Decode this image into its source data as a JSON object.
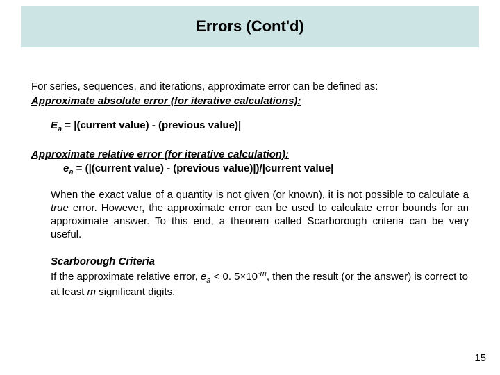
{
  "title": "Errors (Cont'd)",
  "intro": "For series, sequences, and iterations,  approximate error can be defined as:",
  "abs_error_head": "Approximate absolute error (for iterative calculations):",
  "Ea_symbol": "E",
  "Ea_sub": "a",
  "Ea_eq": " = ",
  "Ea_rhs": "(current value) - (previous value)",
  "rel_error_head": "Approximate relative error (for iterative calculation):",
  "ea_symbol": "e",
  "ea_sub": "a",
  "ea_eq": " = (",
  "ea_mid": "(current value) - (previous value)",
  "ea_close": ")/",
  "ea_denom": "current value",
  "para_1a": "When the exact value of a quantity is not given (or known), it is not possible to calculate a ",
  "para_1_true": "true",
  "para_1b": " error. However, the approximate error can be used to calculate error bounds for an approximate answer. To this end, a theorem called Scarborough criteria can be very useful.",
  "criteria_head": "Scarborough Criteria",
  "criteria_a": "If the approximate relative error, ",
  "criteria_sym": "e",
  "criteria_sub": "a",
  "criteria_b": " < 0. 5",
  "criteria_times": "×",
  "criteria_c": "10",
  "criteria_exp_prefix": "-",
  "criteria_exp_m": "m",
  "criteria_d": ", then the result (or the answer) is correct to at least ",
  "criteria_m": "m",
  "criteria_e": " significant digits.",
  "bar": "|",
  "page_num": "15"
}
